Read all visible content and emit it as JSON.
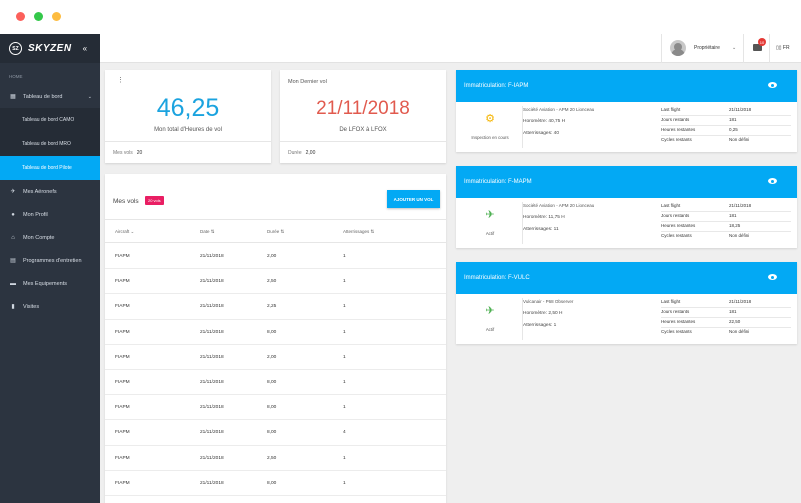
{
  "window": {
    "dot_colors": [
      "#fc605b",
      "#34c84a",
      "#fdbc40"
    ]
  },
  "brand": {
    "logo": "SZ",
    "name": "SKYZEN",
    "collapse_icon": "double-chevron-left-icon"
  },
  "sidebar": {
    "section": "HOME",
    "dashboard": {
      "label": "Tableau de bord",
      "icon": "grid-icon"
    },
    "sub_items": [
      {
        "label": "Tableau de bord CAMO",
        "active": false
      },
      {
        "label": "Tableau de bord MRO",
        "active": false
      },
      {
        "label": "Tableau de bord Pilote",
        "active": true
      }
    ],
    "items": [
      {
        "label": "Mes Aéronefs",
        "icon": "plane-icon"
      },
      {
        "label": "Mon Profil",
        "icon": "user-icon"
      },
      {
        "label": "Mon Compte",
        "icon": "home-icon"
      },
      {
        "label": "Programmes d'entretien",
        "icon": "clipboard-icon"
      },
      {
        "label": "Mes Equipements",
        "icon": "toolbox-icon"
      },
      {
        "label": "Visites",
        "icon": "document-icon"
      }
    ]
  },
  "topbar": {
    "user": "Propriétaire",
    "mail_count": "10",
    "language": "FR"
  },
  "stats": {
    "hours_value": "46,25",
    "hours_caption": "Mon total d'Heures de vol",
    "vols_label": "Mes vols",
    "vols_value": "20",
    "last_title": "Mon Dernier vol",
    "last_date": "21/11/2018",
    "last_route": "De LFOX à LFOX",
    "duree_label": "Durée",
    "duree_value": "2,00"
  },
  "flights": {
    "title": "Mes vols",
    "badge": "20 vols",
    "add_label": "AJOUTER UN VOL",
    "columns": [
      "Aircraft",
      "Date",
      "Durée",
      "Atterrissages"
    ],
    "rows": [
      [
        "FIAPM",
        "21/11/2018",
        "2,00",
        "1"
      ],
      [
        "FIAPM",
        "21/11/2018",
        "2,50",
        "1"
      ],
      [
        "FIAPM",
        "21/11/2018",
        "2,25",
        "1"
      ],
      [
        "FIAPM",
        "21/11/2018",
        "8,00",
        "1"
      ],
      [
        "FIAPM",
        "21/11/2018",
        "2,00",
        "1"
      ],
      [
        "FIAPM",
        "21/11/2018",
        "8,00",
        "1"
      ],
      [
        "FIAPM",
        "21/11/2018",
        "8,00",
        "1"
      ],
      [
        "FIAPM",
        "21/11/2018",
        "8,00",
        "4"
      ],
      [
        "FIAPM",
        "21/11/2018",
        "2,50",
        "1"
      ],
      [
        "FIAPM",
        "21/11/2018",
        "8,00",
        "1"
      ]
    ]
  },
  "aircraft": [
    {
      "title": "Immatriculation: F-IAPM",
      "status": "Inspection en cours",
      "status_icon": "inspection-icon",
      "icon_color": "#f5b400",
      "owner": "Société Aviation - APM 20 Lionceau",
      "horometre": "Horomètre: 40,75 H",
      "atterrissages": "Atterrissages: 40",
      "kv": [
        [
          "Last flight",
          "21/11/2018"
        ],
        [
          "Jours restants",
          "181"
        ],
        [
          "Heures restantes",
          "0,25"
        ],
        [
          "Cycles restants",
          "Non défini"
        ]
      ]
    },
    {
      "title": "Immatriculation: F-MAPM",
      "status": "Actif",
      "status_icon": "airplane-icon",
      "icon_color": "#4caf50",
      "owner": "Société Aviation - APM 20 Lionceau",
      "horometre": "Horomètre: 11,75 H",
      "atterrissages": "Atterrissages: 11",
      "kv": [
        [
          "Last flight",
          "21/11/2018"
        ],
        [
          "Jours restants",
          "181"
        ],
        [
          "Heures restantes",
          "18,25"
        ],
        [
          "Cycles restants",
          "Non défini"
        ]
      ]
    },
    {
      "title": "Immatriculation: F-VULC",
      "status": "Actif",
      "status_icon": "airplane-icon",
      "icon_color": "#4caf50",
      "owner": "Vulcanair - P68 Observer",
      "horometre": "Horomètre: 2,50 H",
      "atterrissages": "Atterrissages: 1",
      "kv": [
        [
          "Last flight",
          "21/11/2018"
        ],
        [
          "Jours restants",
          "181"
        ],
        [
          "Heures restantes",
          "22,50"
        ],
        [
          "Cycles restants",
          "Non défini"
        ]
      ]
    }
  ],
  "colors": {
    "accent": "#03a9f4",
    "hours": "#1ba3df",
    "last": "#e15a4e",
    "badge": "#e91e63",
    "sidebar": "#2c3440"
  }
}
